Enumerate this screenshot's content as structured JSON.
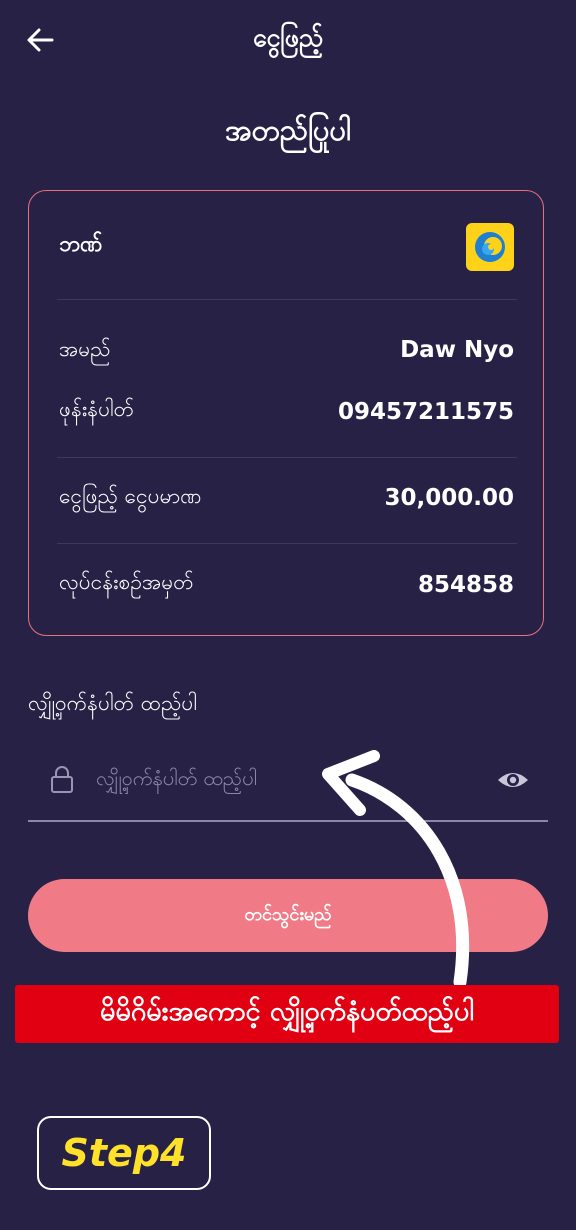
{
  "header": {
    "title": "ငွေဖြည့်",
    "back_icon": "arrow-left-icon"
  },
  "page": {
    "heading": "အတည်ပြုပါ"
  },
  "card": {
    "bank_label": "ဘဏ်",
    "bank_logo_icon": "bank-logo-icon",
    "rows": [
      {
        "label": "အမည်",
        "value": "Daw Nyo"
      },
      {
        "label": "ဖုန်းနံပါတ်",
        "value": "09457211575"
      },
      {
        "label": "ငွေဖြည့် ငွေပမာဏ",
        "value": "30,000.00"
      },
      {
        "label": "လုပ်ငန်းစဉ်အမှတ်",
        "value": "854858"
      }
    ]
  },
  "password": {
    "label": "လျှို့ဝှက်နံပါတ် ထည့်ပါ",
    "placeholder": "လျှို့ဝှက်နံပါတ် ထည့်ပါ",
    "lock_icon": "lock-icon",
    "eye_icon": "eye-icon"
  },
  "submit": {
    "label": "တင်သွင်းမည်"
  },
  "overlay": {
    "instruction": "မိမိဂိမ်းအကောင့် လျှို့ဝှက်နံပတ်ထည့်ပါ",
    "step": "Step4",
    "arrow_icon": "curved-arrow-icon"
  },
  "colors": {
    "background": "#272146",
    "accent": "#f07a86",
    "card_border": "#e9707e",
    "banner": "#e00012",
    "step_text": "#ffe12a",
    "logo": "#ffd21a"
  }
}
